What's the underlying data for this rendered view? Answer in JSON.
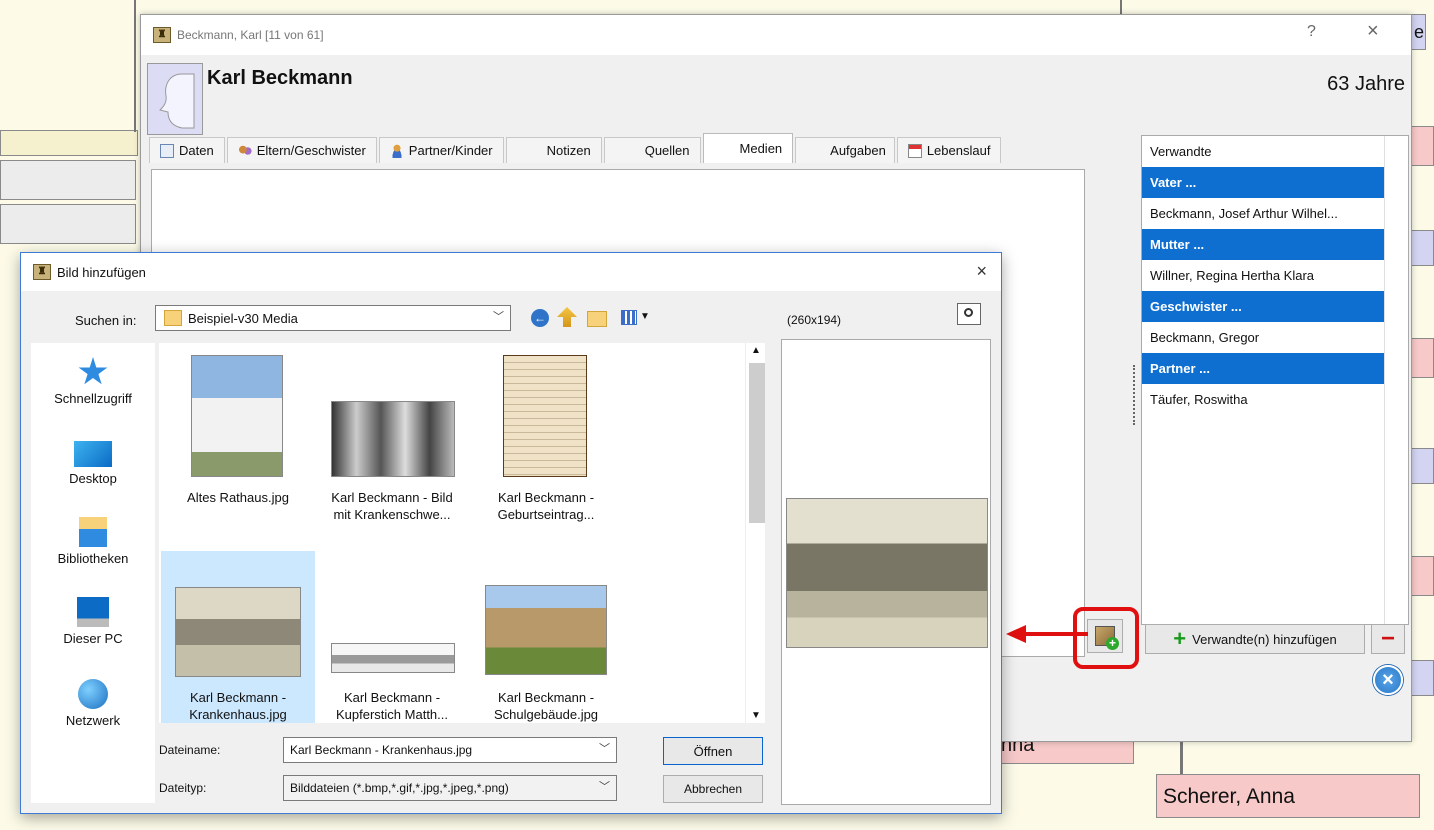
{
  "background": {
    "right_edge_letter": "e",
    "name_partial": "nna",
    "name_full": "Scherer, Anna"
  },
  "main_window": {
    "title": "Beckmann, Karl [11 von 61]",
    "help_label": "?",
    "close_label": "×",
    "person_name": "Karl Beckmann",
    "age": "63 Jahre",
    "tabs": [
      {
        "label": "Daten",
        "icon": "document-icon"
      },
      {
        "label": "Eltern/Geschwister",
        "icon": "family-icon"
      },
      {
        "label": "Partner/Kinder",
        "icon": "person-icon"
      },
      {
        "label": "Notizen"
      },
      {
        "label": "Quellen"
      },
      {
        "label": "Medien"
      },
      {
        "label": "Aufgaben"
      },
      {
        "label": "Lebenslauf",
        "icon": "calendar-icon"
      }
    ],
    "active_tab": "Medien",
    "relatives": {
      "header": "Verwandte",
      "rows": [
        {
          "text": "Vater ...",
          "heading": true
        },
        {
          "text": "Beckmann, Josef Arthur Wilhel...",
          "heading": false
        },
        {
          "text": "Mutter ...",
          "heading": true
        },
        {
          "text": "Willner, Regina Hertha Klara",
          "heading": false
        },
        {
          "text": "Geschwister ...",
          "heading": true
        },
        {
          "text": "Beckmann, Gregor",
          "heading": false
        },
        {
          "text": "Partner ...",
          "heading": true
        },
        {
          "text": "Täufer, Roswitha",
          "heading": false
        }
      ],
      "add_button": "Verwandte(n) hinzufügen",
      "remove_label": "−"
    },
    "accent_blue": "#0f6fd0",
    "highlight_red": "#e01010"
  },
  "dialog": {
    "title": "Bild hinzufügen",
    "close_label": "×",
    "look_in_label": "Suchen in:",
    "look_in_value": "Beispiel-v30 Media",
    "preview_size": "(260x194)",
    "places": [
      {
        "label": "Schnellzugriff",
        "icon": "star-icon"
      },
      {
        "label": "Desktop",
        "icon": "desktop-icon"
      },
      {
        "label": "Bibliotheken",
        "icon": "library-icon"
      },
      {
        "label": "Dieser PC",
        "icon": "computer-icon"
      },
      {
        "label": "Netzwerk",
        "icon": "network-icon"
      }
    ],
    "files": [
      {
        "line1": "Altes Rathaus.jpg",
        "line2": ""
      },
      {
        "line1": "Karl Beckmann - Bild",
        "line2": "mit Krankenschwe..."
      },
      {
        "line1": "Karl Beckmann -",
        "line2": "Geburtseintrag..."
      },
      {
        "line1": "Karl Beckmann -",
        "line2": "Krankenhaus.jpg"
      },
      {
        "line1": "Karl Beckmann -",
        "line2": "Kupferstich Matth..."
      },
      {
        "line1": "Karl Beckmann -",
        "line2": "Schulgebäude.jpg"
      }
    ],
    "selected_file_index": 3,
    "filename_label": "Dateiname:",
    "filename_value": "Karl Beckmann - Krankenhaus.jpg",
    "filetype_label": "Dateityp:",
    "filetype_value": "Bilddateien (*.bmp,*.gif,*.jpg,*.jpeg,*.png)",
    "open_button": "Öffnen",
    "cancel_button": "Abbrechen"
  }
}
